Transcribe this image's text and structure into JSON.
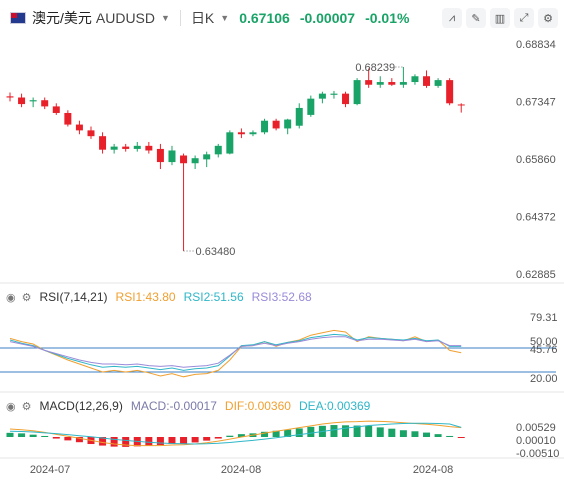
{
  "header": {
    "symbol_name": "澳元/美元",
    "symbol_code": "AUDUSD",
    "period": "日K",
    "last_price": "0.67106",
    "change": "-0.00007",
    "change_pct": "-0.01%",
    "tools": [
      "chart-style-icon",
      "drawing-icon",
      "indicator-icon",
      "fullscreen-icon",
      "settings-icon"
    ]
  },
  "colors": {
    "up": "#1aa367",
    "down": "#e8202a",
    "rsi1": "#f0a030",
    "rsi2": "#2fb7c8",
    "rsi3": "#9a8ad8",
    "level_line": "#3b82c4"
  },
  "rsi_legend": {
    "name": "RSI(7,14,21)",
    "rsi1": "RSI1:43.80",
    "rsi2": "RSI2:51.56",
    "rsi3": "RSI3:52.68"
  },
  "macd_legend": {
    "name": "MACD(12,26,9)",
    "macd": "MACD:-0.00017",
    "dif": "DIF:0.00360",
    "dea": "DEA:0.00369"
  },
  "chart_data": {
    "type": "candlestick",
    "price_axis": {
      "ticks": [
        "0.68834",
        "0.67347",
        "0.65860",
        "0.64372",
        "0.62885"
      ],
      "range": [
        0.62885,
        0.68834
      ]
    },
    "annotations": {
      "high": "0.68239",
      "low": "0.63480"
    },
    "x_ticks": [
      "2024-07",
      "2024-08",
      "2024-08"
    ],
    "candles": [
      {
        "o": 0.6748,
        "h": 0.6758,
        "l": 0.6735,
        "c": 0.6745
      },
      {
        "o": 0.6745,
        "h": 0.6755,
        "l": 0.672,
        "c": 0.6728
      },
      {
        "o": 0.6735,
        "h": 0.6745,
        "l": 0.672,
        "c": 0.6738
      },
      {
        "o": 0.6738,
        "h": 0.6745,
        "l": 0.6715,
        "c": 0.6722
      },
      {
        "o": 0.6722,
        "h": 0.673,
        "l": 0.67,
        "c": 0.6705
      },
      {
        "o": 0.6705,
        "h": 0.6712,
        "l": 0.667,
        "c": 0.6675
      },
      {
        "o": 0.6675,
        "h": 0.6685,
        "l": 0.665,
        "c": 0.666
      },
      {
        "o": 0.666,
        "h": 0.667,
        "l": 0.6638,
        "c": 0.6645
      },
      {
        "o": 0.6645,
        "h": 0.6655,
        "l": 0.66,
        "c": 0.661
      },
      {
        "o": 0.661,
        "h": 0.6625,
        "l": 0.66,
        "c": 0.6618
      },
      {
        "o": 0.6618,
        "h": 0.6625,
        "l": 0.6605,
        "c": 0.6612
      },
      {
        "o": 0.6612,
        "h": 0.663,
        "l": 0.6605,
        "c": 0.662
      },
      {
        "o": 0.662,
        "h": 0.663,
        "l": 0.66,
        "c": 0.6608
      },
      {
        "o": 0.6612,
        "h": 0.6625,
        "l": 0.656,
        "c": 0.6578
      },
      {
        "o": 0.6578,
        "h": 0.662,
        "l": 0.657,
        "c": 0.6608
      },
      {
        "o": 0.6595,
        "h": 0.66,
        "l": 0.6348,
        "c": 0.6575
      },
      {
        "o": 0.6575,
        "h": 0.6595,
        "l": 0.656,
        "c": 0.6588
      },
      {
        "o": 0.6585,
        "h": 0.6605,
        "l": 0.6565,
        "c": 0.6598
      },
      {
        "o": 0.6598,
        "h": 0.6625,
        "l": 0.659,
        "c": 0.662
      },
      {
        "o": 0.66,
        "h": 0.666,
        "l": 0.6598,
        "c": 0.6655
      },
      {
        "o": 0.6655,
        "h": 0.6665,
        "l": 0.664,
        "c": 0.665
      },
      {
        "o": 0.665,
        "h": 0.666,
        "l": 0.6645,
        "c": 0.6655
      },
      {
        "o": 0.6655,
        "h": 0.669,
        "l": 0.665,
        "c": 0.6685
      },
      {
        "o": 0.6685,
        "h": 0.669,
        "l": 0.666,
        "c": 0.6665
      },
      {
        "o": 0.6665,
        "h": 0.669,
        "l": 0.665,
        "c": 0.6688
      },
      {
        "o": 0.6672,
        "h": 0.673,
        "l": 0.6665,
        "c": 0.6718
      },
      {
        "o": 0.67,
        "h": 0.675,
        "l": 0.6695,
        "c": 0.6742
      },
      {
        "o": 0.6742,
        "h": 0.676,
        "l": 0.673,
        "c": 0.6755
      },
      {
        "o": 0.6752,
        "h": 0.6762,
        "l": 0.6742,
        "c": 0.6755
      },
      {
        "o": 0.6755,
        "h": 0.676,
        "l": 0.672,
        "c": 0.6728
      },
      {
        "o": 0.6728,
        "h": 0.6795,
        "l": 0.6725,
        "c": 0.679
      },
      {
        "o": 0.679,
        "h": 0.682,
        "l": 0.677,
        "c": 0.6778
      },
      {
        "o": 0.6778,
        "h": 0.68,
        "l": 0.677,
        "c": 0.6785
      },
      {
        "o": 0.6785,
        "h": 0.6795,
        "l": 0.6775,
        "c": 0.6778
      },
      {
        "o": 0.6778,
        "h": 0.6824,
        "l": 0.677,
        "c": 0.6785
      },
      {
        "o": 0.6785,
        "h": 0.6805,
        "l": 0.6778,
        "c": 0.68
      },
      {
        "o": 0.68,
        "h": 0.6815,
        "l": 0.677,
        "c": 0.6775
      },
      {
        "o": 0.6775,
        "h": 0.6795,
        "l": 0.677,
        "c": 0.679
      },
      {
        "o": 0.679,
        "h": 0.6795,
        "l": 0.6725,
        "c": 0.673
      },
      {
        "o": 0.6727,
        "h": 0.673,
        "l": 0.6706,
        "c": 0.6726
      }
    ],
    "rsi_axis": {
      "ticks": [
        "79.31",
        "50.00",
        "45.76",
        "20.00"
      ],
      "range": [
        0,
        100
      ],
      "levels": [
        50,
        20
      ]
    },
    "rsi_series": [
      {
        "name": "RSI1",
        "values": [
          62,
          58,
          55,
          47,
          41,
          35,
          30,
          25,
          20,
          22,
          20,
          22,
          19,
          15,
          18,
          14,
          17,
          18,
          22,
          35,
          52,
          53,
          58,
          52,
          57,
          60,
          66,
          69,
          72,
          70,
          58,
          64,
          62,
          61,
          59,
          64,
          58,
          60,
          47,
          44
        ]
      },
      {
        "name": "RSI2",
        "values": [
          60,
          56,
          53,
          47,
          42,
          37,
          33,
          29,
          26,
          27,
          26,
          27,
          25,
          23,
          25,
          22,
          24,
          25,
          28,
          40,
          53,
          54,
          58,
          54,
          57,
          59,
          63,
          65,
          67,
          66,
          60,
          63,
          62,
          61,
          60,
          62,
          59,
          60,
          52,
          52
        ]
      },
      {
        "name": "RSI3",
        "values": [
          58,
          55,
          52,
          47,
          43,
          39,
          35,
          32,
          30,
          30,
          29,
          30,
          28,
          27,
          28,
          26,
          27,
          28,
          31,
          41,
          52,
          53,
          56,
          53,
          56,
          58,
          61,
          63,
          64,
          64,
          59,
          61,
          61,
          60,
          59,
          61,
          58,
          59,
          53,
          53
        ]
      }
    ],
    "macd_axis": {
      "ticks": [
        "0.00529",
        "0.00010",
        "-0.00510"
      ]
    },
    "macd_bars": [
      0.0016,
      0.0014,
      0.0009,
      0.0004,
      -0.0006,
      -0.0013,
      -0.002,
      -0.0027,
      -0.0033,
      -0.0037,
      -0.0038,
      -0.0036,
      -0.0033,
      -0.0031,
      -0.0027,
      -0.0026,
      -0.0021,
      -0.0014,
      -0.0006,
      0.0005,
      0.0011,
      0.0014,
      0.002,
      0.0024,
      0.0028,
      0.0033,
      0.0039,
      0.0043,
      0.0046,
      0.0045,
      0.0044,
      0.0043,
      0.0037,
      0.0032,
      0.0026,
      0.0022,
      0.0017,
      0.0011,
      0.0004,
      -0.0002
    ],
    "dif_values": [
      0.0031,
      0.0028,
      0.0024,
      0.0018,
      0.001,
      0.0003,
      -0.0005,
      -0.0013,
      -0.0021,
      -0.0027,
      -0.0031,
      -0.0033,
      -0.0033,
      -0.0033,
      -0.0031,
      -0.003,
      -0.0027,
      -0.0022,
      -0.0016,
      -0.0008,
      0.0,
      0.0007,
      0.0015,
      0.0022,
      0.0029,
      0.0036,
      0.0043,
      0.005,
      0.0055,
      0.0058,
      0.0059,
      0.0061,
      0.006,
      0.0058,
      0.0055,
      0.0052,
      0.0049,
      0.0045,
      0.004,
      0.0036
    ],
    "dea_values": [
      0.0022,
      0.0021,
      0.0019,
      0.0016,
      0.0013,
      0.0009,
      0.0005,
      0.0001,
      -0.0004,
      -0.0009,
      -0.0013,
      -0.0017,
      -0.002,
      -0.0023,
      -0.0025,
      -0.0026,
      -0.0027,
      -0.0026,
      -0.0024,
      -0.0021,
      -0.0017,
      -0.0013,
      -0.0008,
      -0.0003,
      0.0003,
      0.0009,
      0.0015,
      0.0021,
      0.0028,
      0.0034,
      0.0039,
      0.0044,
      0.0047,
      0.005,
      0.0052,
      0.0053,
      0.0053,
      0.0052,
      0.005,
      0.0037
    ]
  }
}
